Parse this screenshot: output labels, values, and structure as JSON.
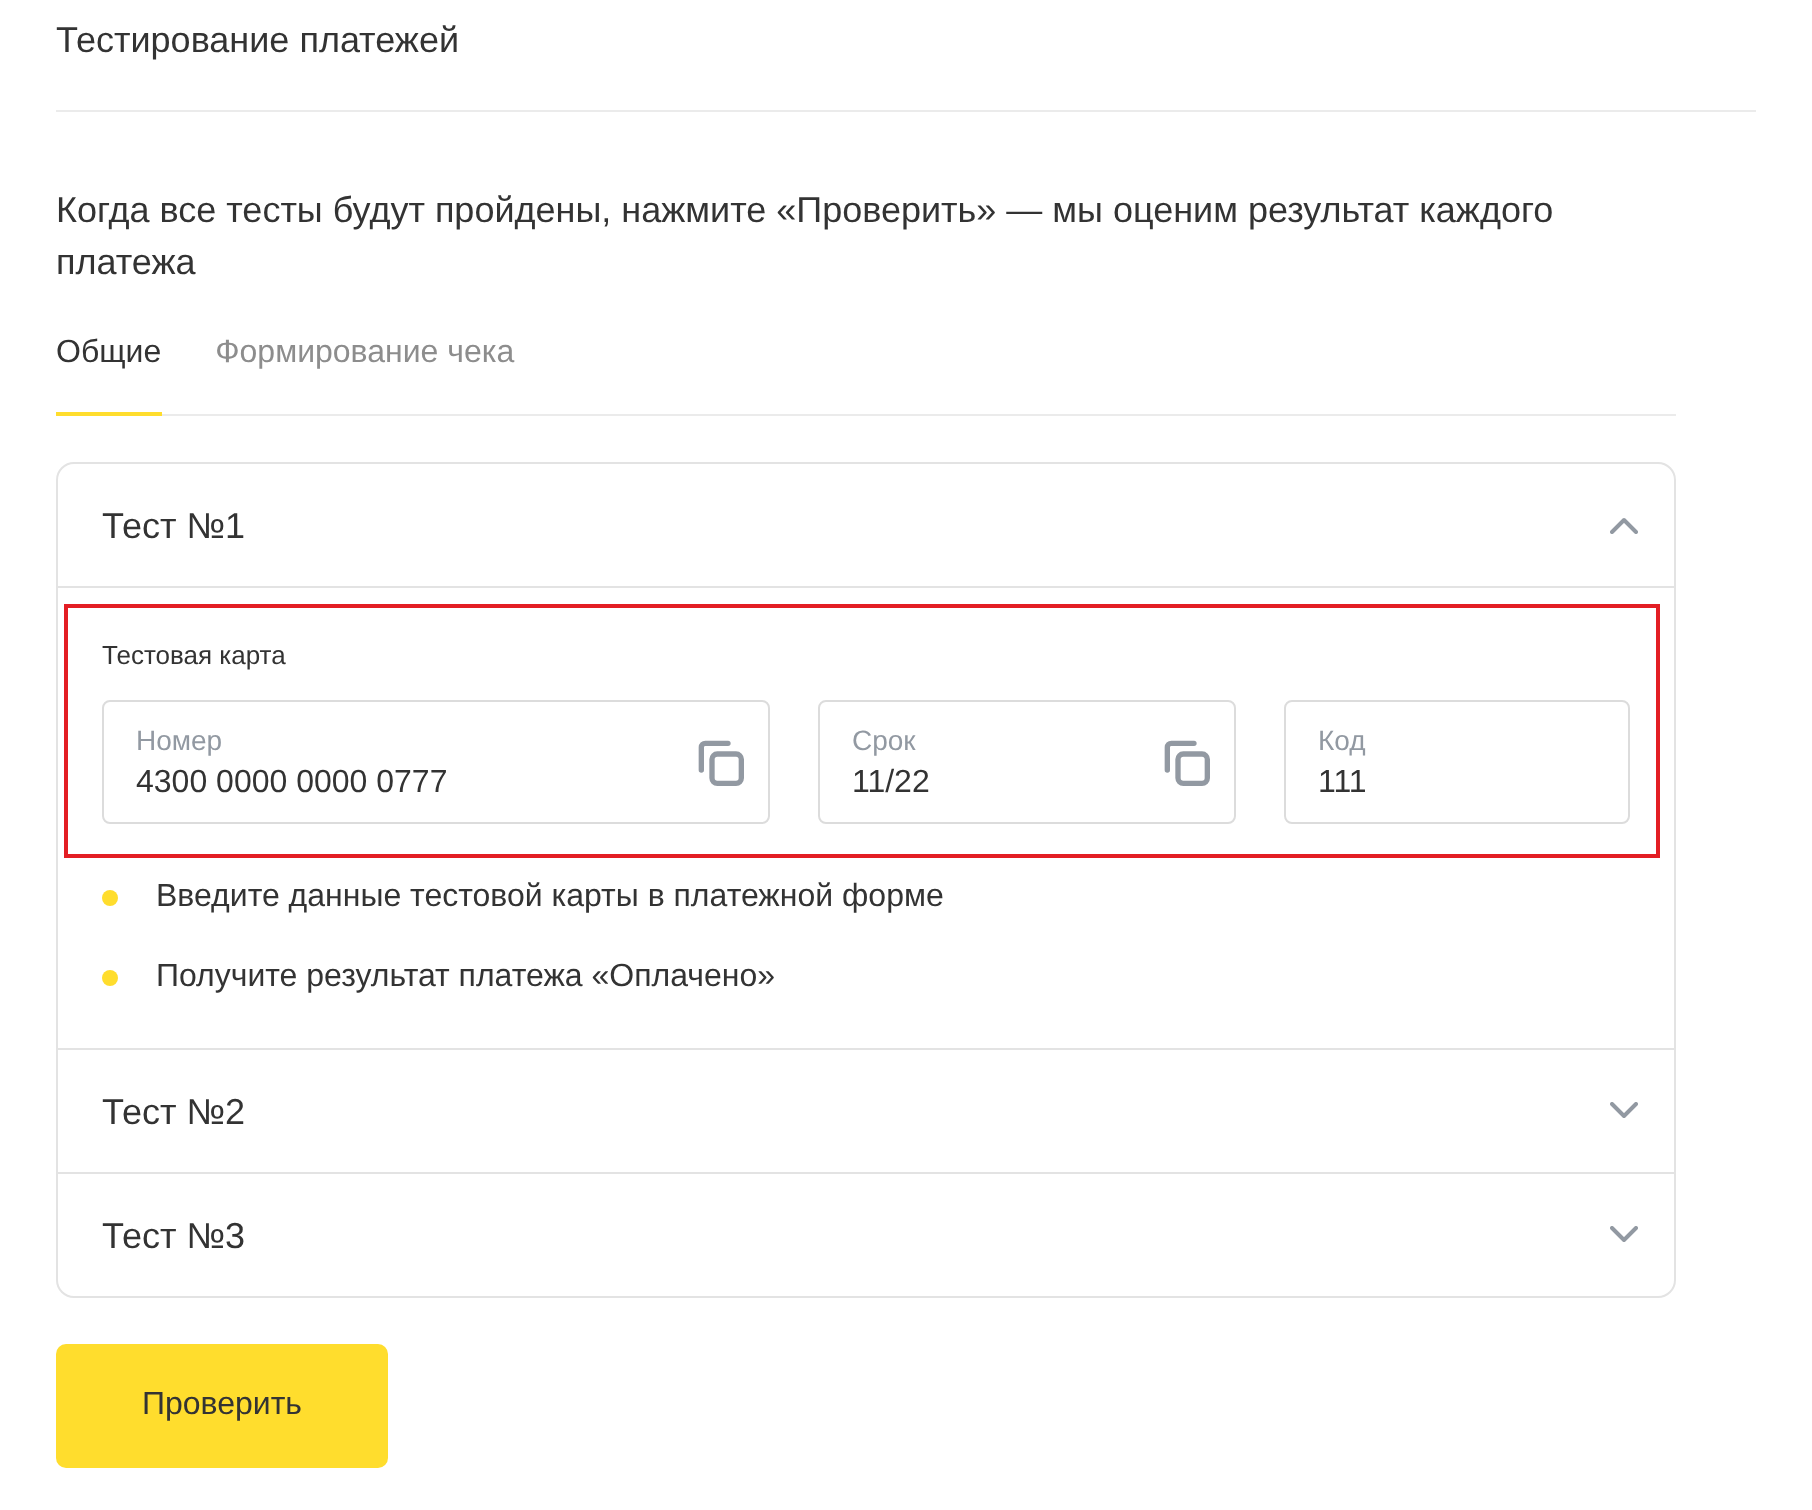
{
  "page": {
    "title": "Тестирование платежей",
    "description": "Когда все тесты будут пройдены, нажмите «Проверить» — мы оценим результат каждого платежа"
  },
  "tabs": [
    {
      "label": "Общие",
      "selected": true
    },
    {
      "label": "Формирование чека",
      "selected": false
    }
  ],
  "tests": [
    {
      "title": "Тест №1",
      "expanded": true,
      "card": {
        "title": "Тестовая карта",
        "highlighted": true,
        "fields": [
          {
            "label": "Номер",
            "value": "4300 0000 0000 0777",
            "copyable": true
          },
          {
            "label": "Срок",
            "value": "11/22",
            "copyable": true
          },
          {
            "label": "Код",
            "value": "111",
            "copyable": false
          }
        ]
      },
      "steps": [
        "Введите данные тестовой карты в платежной форме",
        "Получите результат платежа «Оплачено»"
      ]
    },
    {
      "title": "Тест №2",
      "expanded": false
    },
    {
      "title": "Тест №3",
      "expanded": false
    }
  ],
  "button": {
    "label": "Проверить"
  }
}
